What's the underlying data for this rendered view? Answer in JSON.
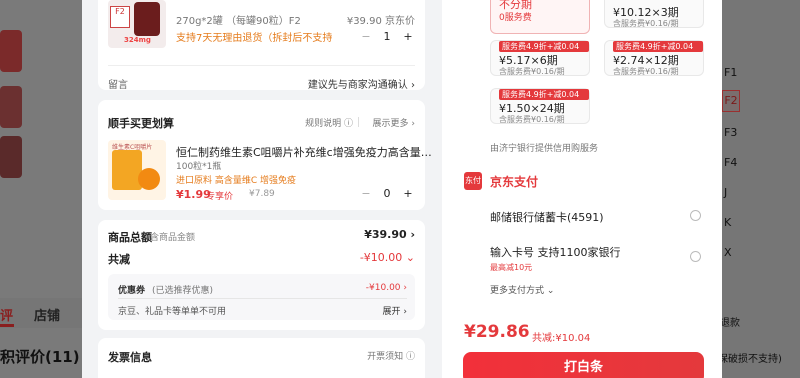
{
  "background": {
    "tabs": [
      "评",
      "店铺"
    ],
    "review_title": "积评价(11)",
    "sizes": [
      "F1",
      "F2",
      "F3",
      "F4",
      "J",
      "K",
      "X"
    ],
    "right_note_1": "退款",
    "right_note_2": "保破损不支持)"
  },
  "product": {
    "badge": "F2",
    "image_tag": "324mg",
    "spec": "270g*2罐 （每罐90粒）F2",
    "old_price": "¥39.90 京东价",
    "refund_note": "支持7天无理由退货（拆封后不支持",
    "qty_minus": "−",
    "qty_value": "1",
    "qty_plus": "+"
  },
  "message": {
    "label": "留言",
    "hint": "建议先与商家沟通确认 ›"
  },
  "addon": {
    "title": "顺手买更划算",
    "rules": "规则说明 ⓘ",
    "more": "展示更多 ›",
    "image_label": "维生素C咀嚼片",
    "name": "恒仁制药维生素C咀嚼片补充维c增强免疫力高含量…",
    "spec": "100粒*1瓶",
    "tags": "进口原料 高含量维C 增强免疫",
    "price": "¥1.99",
    "price_tag": "专享价",
    "old_price": "¥7.89",
    "qty_minus": "−",
    "qty_value": "0",
    "qty_plus": "+"
  },
  "summary": {
    "total_label": "商品总额",
    "total_sub": "含商品金额",
    "total_value": "¥39.90 ›",
    "reduce_label": "共减",
    "reduce_value": "-¥10.00 ⌄",
    "coupon_label": "优惠券",
    "coupon_sub": "(已选推荐优惠)",
    "coupon_value": "-¥10.00 ›",
    "bean_label": "京豆、礼品卡等单单不可用",
    "bean_value": "展开 ›"
  },
  "invoice": {
    "label": "发票信息",
    "hint": "开票须知 ⓘ"
  },
  "installments": [
    {
      "badge": "",
      "amount": "不分期",
      "fee": "0服务费",
      "selected": true
    },
    {
      "badge": "",
      "amount": "¥10.12×3期",
      "fee": "含服务费¥0.16/期",
      "selected": false
    },
    {
      "badge": "服务费4.9折+减0.04元",
      "amount": "¥5.17×6期",
      "fee": "含服务费¥0.16/期",
      "selected": false
    },
    {
      "badge": "服务费4.9折+减0.04元",
      "amount": "¥2.74×12期",
      "fee": "含服务费¥0.16/期",
      "selected": false
    },
    {
      "badge": "服务费4.9折+减0.04元",
      "amount": "¥1.50×24期",
      "fee": "含服务费¥0.16/期",
      "selected": false
    }
  ],
  "credit_note": "由济宁银行提供信用购服务",
  "jd_pay": {
    "icon_text": "东付",
    "title": "京东支付",
    "option1": "邮储银行储蓄卡(4591)",
    "option2": "输入卡号 支持1100家银行",
    "option2_sub": "最高减10元",
    "more": "更多支付方式 ⌄"
  },
  "footer": {
    "total": "¥29.86",
    "saved": "共减:¥10.04",
    "pay_button": "打白条"
  },
  "colors": {
    "accent": "#e4393c",
    "orange": "#e57b1b"
  }
}
